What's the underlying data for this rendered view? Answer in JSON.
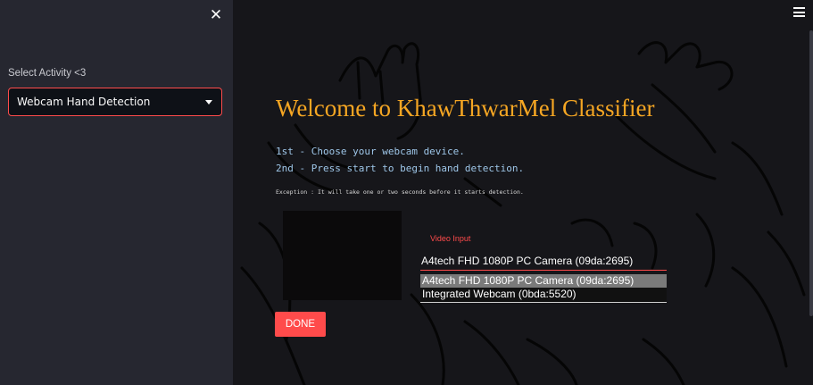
{
  "sidebar": {
    "close_symbol": "✕",
    "select_label": "Select Activity <3",
    "select_value": "Webcam Hand Detection"
  },
  "main": {
    "title": "Welcome to KhawThwarMel Classifier",
    "step1": "1st - Choose your webcam device.",
    "step2": "2nd - Press start to begin hand detection.",
    "note": "Exception : It will take one or two seconds before it starts detection.",
    "video_input_label": "Video Input",
    "device_selected": "A4tech FHD 1080P PC Camera (09da:2695)",
    "device_options": [
      "A4tech FHD 1080P PC Camera (09da:2695)",
      "Integrated Webcam (0bda:5520)"
    ],
    "done_label": "DONE"
  },
  "colors": {
    "accent": "#ff4b4b",
    "title": "#f5a623",
    "step_text": "#9ec6e8",
    "sidebar_bg": "#262730",
    "main_bg": "#16161a"
  }
}
